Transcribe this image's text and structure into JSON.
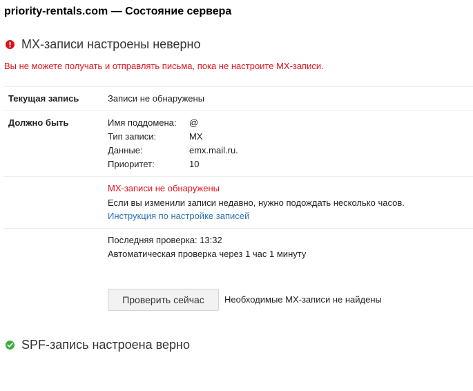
{
  "page": {
    "title": "priority-rentals.com — Состояние сервера"
  },
  "mx": {
    "heading": "MX-записи настроены неверно",
    "status_color": "#e0141e",
    "status_icon": "exclamation-icon",
    "warning": "Вы не можете получать и отправлять письма, пока не настроите MX-записи.",
    "current": {
      "label": "Текущая запись",
      "value": "Записи не обнаружены"
    },
    "expected": {
      "label": "Должно быть",
      "fields": [
        {
          "name": "Имя поддомена:",
          "value": "@"
        },
        {
          "name": "Тип записи:",
          "value": "MX"
        },
        {
          "name": "Данные:",
          "value": "emx.mail.ru."
        },
        {
          "name": "Приоритет:",
          "value": "10"
        }
      ]
    },
    "error": {
      "title": "MX-записи не обнаружены",
      "hint": "Если вы изменили записи недавно, нужно подождать несколько часов.",
      "help_link": "Инструкция по настройке записей"
    },
    "check": {
      "last": "Последняя проверка: 13:32",
      "auto": "Автоматическая проверка через 1 час 1 минуту",
      "button_label": "Проверить сейчас",
      "result": "Необходимые MX-записи не найдены"
    }
  },
  "spf": {
    "heading": "SPF-запись настроена верно",
    "status_color": "#3bad3f",
    "status_icon": "checkmark-icon"
  }
}
